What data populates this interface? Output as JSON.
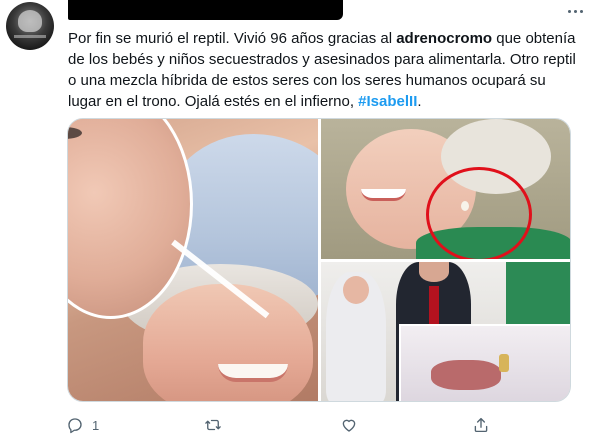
{
  "tweet": {
    "text_parts": {
      "p1": "Por fin se murió el reptil. Vivió 96 años gracias al ",
      "p2": "adrenocromo",
      "p3": " que obtenía de los bebés y niños secuestrados y asesinados para alimentarla. Otro reptil o una mezcla híbrida de estos seres con los seres humanos ocupará su lugar en el trono. Ojalá estés en el infierno, ",
      "hashtag": "#IsabelII",
      "p4": "."
    },
    "reply_count": "1",
    "colors": {
      "text": "#0f1419",
      "secondary": "#536471",
      "accent": "#1d9bf0",
      "border": "#cfd9de"
    },
    "icons": [
      "more-icon",
      "reply-icon",
      "retweet-icon",
      "like-icon",
      "share-icon"
    ]
  }
}
